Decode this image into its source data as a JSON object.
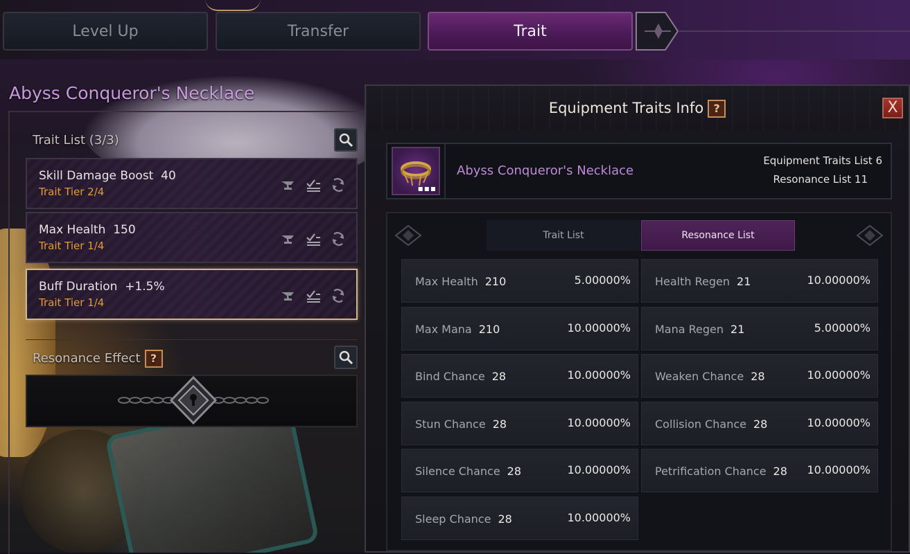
{
  "tabs": [
    {
      "label": "Level Up",
      "active": false
    },
    {
      "label": "Transfer",
      "active": false
    },
    {
      "label": "Trait",
      "active": true
    }
  ],
  "item": {
    "name": "Abyss Conqueror's Necklace",
    "name_color": "#c79bdc"
  },
  "trait_list": {
    "header": "Trait List (3/3)",
    "items": [
      {
        "name": "Skill Damage Boost",
        "value": "40",
        "tier": "Trait Tier 2/4",
        "selected": false
      },
      {
        "name": "Max Health",
        "value": "150",
        "tier": "Trait Tier 1/4",
        "selected": false
      },
      {
        "name": "Buff Duration",
        "value": "+1.5%",
        "tier": "Trait Tier 1/4",
        "selected": true
      }
    ],
    "item_icons": [
      "anvil-icon",
      "checklist-icon",
      "reroll-icon"
    ]
  },
  "resonance": {
    "header": "Resonance Effect",
    "help": "?",
    "status_icon": "locked-chain-icon"
  },
  "info_panel": {
    "title": "Equipment Traits Info",
    "help": "?",
    "close": "X",
    "item_name": "Abyss Conqueror's Necklace",
    "equipment_traits_list": "Equipment Traits List 6",
    "resonance_list": "Resonance List 11",
    "subtabs": [
      {
        "label": "Trait List",
        "active": false
      },
      {
        "label": "Resonance List",
        "active": true
      }
    ],
    "rows": [
      {
        "name": "Max Health",
        "value": "210",
        "chance": "5.00000%"
      },
      {
        "name": "Health Regen",
        "value": "21",
        "chance": "10.00000%"
      },
      {
        "name": "Max Mana",
        "value": "210",
        "chance": "10.00000%"
      },
      {
        "name": "Mana Regen",
        "value": "21",
        "chance": "5.00000%"
      },
      {
        "name": "Bind Chance",
        "value": "28",
        "chance": "10.00000%"
      },
      {
        "name": "Weaken Chance",
        "value": "28",
        "chance": "10.00000%"
      },
      {
        "name": "Stun Chance",
        "value": "28",
        "chance": "10.00000%"
      },
      {
        "name": "Collision Chance",
        "value": "28",
        "chance": "10.00000%"
      },
      {
        "name": "Silence Chance",
        "value": "28",
        "chance": "10.00000%"
      },
      {
        "name": "Petrification Chance",
        "value": "28",
        "chance": "10.00000%"
      },
      {
        "name": "Sleep Chance",
        "value": "28",
        "chance": "10.00000%"
      }
    ]
  },
  "colors": {
    "tier_orange": "#e29a3a",
    "active_tab_purple": "#5a2066",
    "selected_border": "#d2b68e"
  }
}
